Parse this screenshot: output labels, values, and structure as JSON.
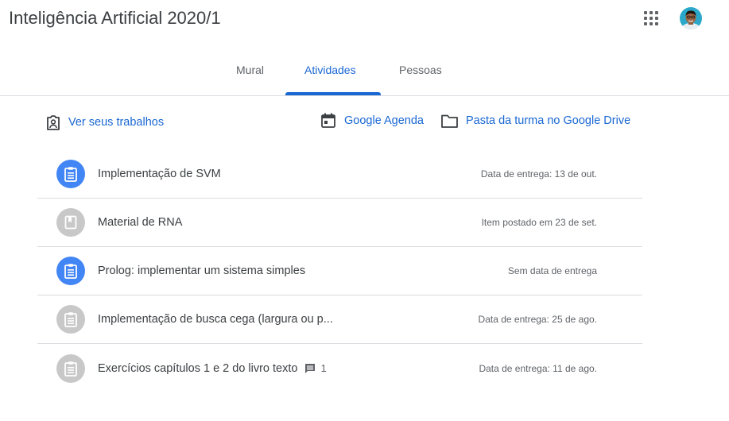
{
  "header": {
    "title": "Inteligência Artificial 2020/1"
  },
  "tabs": [
    {
      "label": "Mural"
    },
    {
      "label": "Atividades"
    },
    {
      "label": "Pessoas"
    }
  ],
  "active_tab": "Atividades",
  "links": {
    "view_work": "Ver seus trabalhos",
    "calendar": "Google Agenda",
    "drive_folder": "Pasta da turma no Google Drive"
  },
  "items": [
    {
      "title": "Implementação de SVM",
      "status": "Data de entrega: 13 de out.",
      "icon": "assignment-icon",
      "color": "#4285f4"
    },
    {
      "title": "Material de RNA",
      "status": "Item postado em 23 de set.",
      "icon": "material-icon",
      "color": "#c8c8c8"
    },
    {
      "title": "Prolog: implementar um sistema simples",
      "status": "Sem data de entrega",
      "icon": "assignment-icon",
      "color": "#4285f4"
    },
    {
      "title": "Implementação de busca cega (largura ou p...",
      "status": "Data de entrega: 25 de ago.",
      "icon": "assignment-icon",
      "color": "#c8c8c8"
    },
    {
      "title": "Exercícios capítulos 1 e 2 do livro texto",
      "status": "Data de entrega: 11 de ago.",
      "icon": "assignment-icon",
      "color": "#c8c8c8",
      "comments": "1"
    }
  ],
  "colors": {
    "accent": "#1967d2",
    "assignment_active": "#4285f4",
    "item_muted": "#c8c8c8"
  }
}
